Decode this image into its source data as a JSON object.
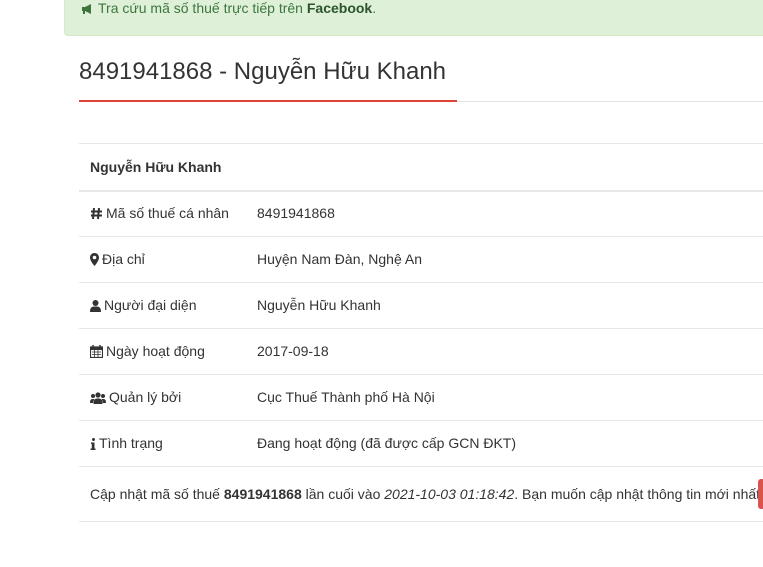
{
  "notice": {
    "prefix": "Tra cứu mã số thuế trực tiếp trên",
    "link": "Facebook",
    "suffix": "."
  },
  "page_title": "8491941868 - Nguyễn Hữu Khanh",
  "company_name": "Nguyễn Hữu Khanh",
  "rows": [
    {
      "icon": "hash-icon",
      "label": "Mã số thuế cá nhân",
      "value": "8491941868"
    },
    {
      "icon": "map-marker-icon",
      "label": "Địa chỉ",
      "value": "Huyện Nam Đàn, Nghệ An"
    },
    {
      "icon": "user-icon",
      "label": "Người đại diện",
      "value": "Nguyễn Hữu Khanh"
    },
    {
      "icon": "calendar-icon",
      "label": "Ngày hoạt động",
      "value": "2017-09-18"
    },
    {
      "icon": "users-icon",
      "label": "Quản lý bởi",
      "value": "Cục Thuế Thành phố Hà Nội"
    },
    {
      "icon": "info-icon",
      "label": "Tình trạng",
      "value": "Đang hoạt động (đã được cấp GCN ĐKT)"
    }
  ],
  "update": {
    "prefix": "Cập nhật mã số thuế",
    "tax_id": "8491941868",
    "middle": "lần cuối vào",
    "timestamp": "2021-10-03 01:18:42",
    "suffix": ". Bạn muốn cập nhật thông tin mới nhất?"
  },
  "colors": {
    "accent": "#e0403a",
    "alert_bg": "#dff0d8",
    "button": "#d9534f"
  }
}
